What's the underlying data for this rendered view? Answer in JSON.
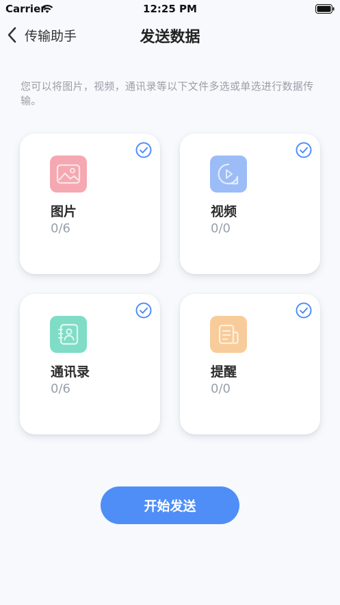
{
  "status_bar": {
    "carrier": "Carrier",
    "time": "12:25 PM"
  },
  "nav": {
    "back_label": "传输助手",
    "title": "发送数据"
  },
  "intro_text": "您可以将图片，视频，通讯录等以下文件多选或单选进行数据传输。",
  "cards": [
    {
      "label": "图片",
      "count": "0/6",
      "icon": "image-icon",
      "color": "#f5a8b1",
      "selected": true
    },
    {
      "label": "视频",
      "count": "0/0",
      "icon": "video-icon",
      "color": "#9bbcf7",
      "selected": true
    },
    {
      "label": "通讯录",
      "count": "0/6",
      "icon": "contacts-icon",
      "color": "#7fdcc6",
      "selected": true
    },
    {
      "label": "提醒",
      "count": "0/0",
      "icon": "reminder-icon",
      "color": "#f7cc9a",
      "selected": true
    }
  ],
  "start_button_label": "开始发送",
  "colors": {
    "accent": "#4f8ef7",
    "check": "#4f8ef7",
    "background": "#f7f9fc"
  }
}
